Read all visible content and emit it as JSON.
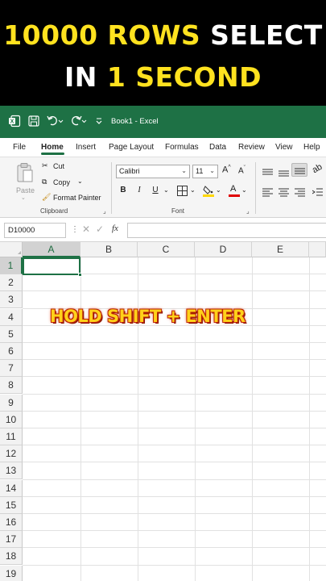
{
  "banner": {
    "line1_highlight": "10000 ROWS",
    "line1_rest": "SELECT",
    "line2_prefix": "IN",
    "line2_highlight": "1 SECOND",
    "highlight_color": "#ffe21f"
  },
  "titlebar": {
    "doc_title": "Book1  -  Excel",
    "brand_color": "#1e7145",
    "icons": [
      "excel-logo-icon",
      "save-icon",
      "undo-icon",
      "redo-icon",
      "customize-qat-icon"
    ]
  },
  "tabs": [
    "File",
    "Home",
    "Insert",
    "Page Layout",
    "Formulas",
    "Data",
    "Review",
    "View",
    "Help"
  ],
  "ribbon": {
    "clipboard": {
      "paste": "Paste",
      "cut": "Cut",
      "copy": "Copy",
      "format_painter": "Format Painter",
      "label": "Clipboard"
    },
    "font": {
      "font_name": "Calibri",
      "font_size": "11",
      "grow": "A",
      "shrink": "A",
      "bold": "B",
      "italic": "I",
      "underline": "U",
      "font_color_letter": "A",
      "label": "Font"
    }
  },
  "formula_bar": {
    "name_box": "D10000",
    "fx": "fx",
    "value": ""
  },
  "grid": {
    "columns": [
      "A",
      "B",
      "C",
      "D",
      "E"
    ],
    "rows": [
      "1",
      "2",
      "3",
      "4",
      "5",
      "6",
      "7",
      "8",
      "9",
      "10",
      "11",
      "12",
      "13",
      "14",
      "15",
      "16",
      "17",
      "18",
      "19"
    ],
    "active_cell": "A1"
  },
  "overlay": {
    "text": "HOLD SHIFT + ENTER"
  }
}
